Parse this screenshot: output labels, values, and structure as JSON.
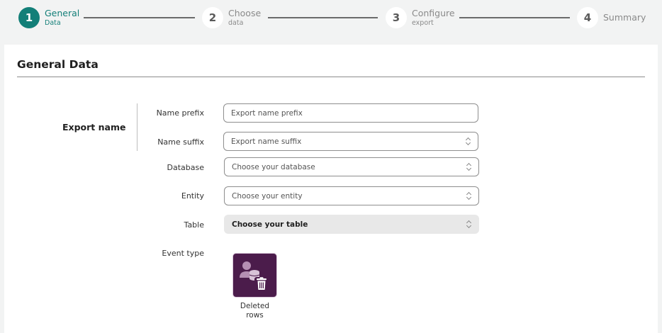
{
  "stepper": {
    "steps": [
      {
        "number": "1",
        "title": "General",
        "subtitle": "Data",
        "state": "active"
      },
      {
        "number": "2",
        "title": "Choose",
        "subtitle": "data",
        "state": "upcoming"
      },
      {
        "number": "3",
        "title": "Configure",
        "subtitle": "export",
        "state": "upcoming"
      },
      {
        "number": "4",
        "title": "Summary",
        "subtitle": "",
        "state": "upcoming"
      }
    ],
    "active_color": "#137f78"
  },
  "card": {
    "title": "General Data",
    "section_label": "Export name",
    "fields": {
      "name_prefix": {
        "label": "Name prefix",
        "placeholder": "Export name prefix",
        "value": ""
      },
      "name_suffix": {
        "label": "Name suffix",
        "placeholder": "Export name suffix",
        "value": ""
      },
      "database": {
        "label": "Database",
        "selected": "Choose your database"
      },
      "entity": {
        "label": "Entity",
        "selected": "Choose your entity"
      },
      "table": {
        "label": "Table",
        "selected": "Choose your table"
      }
    },
    "event_type": {
      "label": "Event type",
      "options": [
        {
          "label": "Deleted rows",
          "icon": "deleted-rows-icon",
          "color": "#4b1c4b"
        }
      ]
    }
  }
}
